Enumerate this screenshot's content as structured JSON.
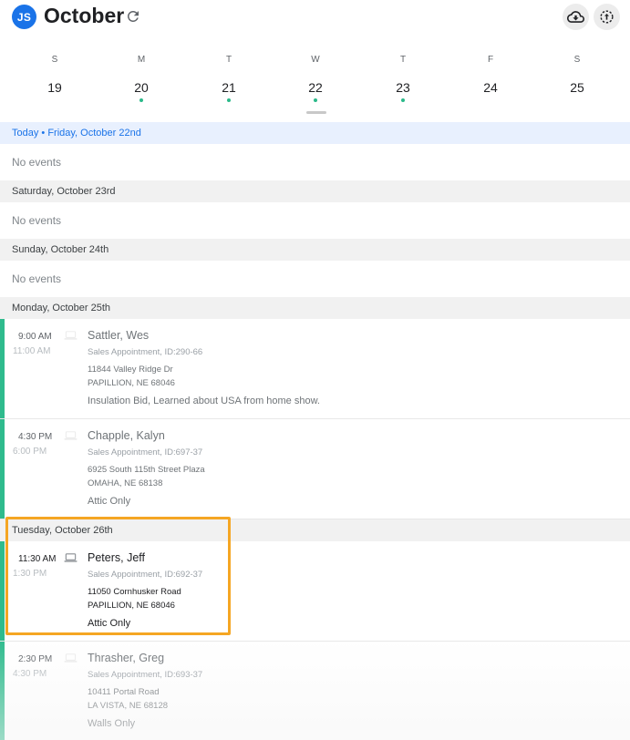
{
  "header": {
    "avatar_initials": "JS",
    "title": "October",
    "icons": {
      "refresh": "refresh-icon",
      "download": "cloud-download-icon",
      "sync": "sync-icon"
    }
  },
  "week": {
    "days": [
      {
        "letter": "S",
        "num": "19",
        "has_events": false
      },
      {
        "letter": "M",
        "num": "20",
        "has_events": true
      },
      {
        "letter": "T",
        "num": "21",
        "has_events": true
      },
      {
        "letter": "W",
        "num": "22",
        "has_events": true
      },
      {
        "letter": "T",
        "num": "23",
        "has_events": true
      },
      {
        "letter": "F",
        "num": "24",
        "has_events": false
      },
      {
        "letter": "S",
        "num": "25",
        "has_events": false
      }
    ]
  },
  "agenda": {
    "today_header": "Today • Friday,  October 22nd",
    "no_events_text": "No events",
    "saturday_header": "Saturday,  October 23rd",
    "sunday_header": "Sunday,  October 24th",
    "monday_header": "Monday,  October 25th",
    "tuesday_header": "Tuesday,  October 26th",
    "events": [
      {
        "start": "9:00 AM",
        "end": "11:00 AM",
        "name": "Sattler, Wes",
        "subtitle": "Sales Appointment, ID:290-66",
        "address1": "11844 Valley Ridge Dr",
        "address2": "PAPILLION, NE 68046",
        "note": "Insulation Bid, Learned about USA from home show."
      },
      {
        "start": "4:30 PM",
        "end": "6:00 PM",
        "name": "Chapple, Kalyn",
        "subtitle": "Sales Appointment, ID:697-37",
        "address1": "6925 South 115th Street Plaza",
        "address2": "OMAHA, NE 68138",
        "note": "Attic Only"
      },
      {
        "start": "11:30 AM",
        "end": "1:30 PM",
        "name": "Peters, Jeff",
        "subtitle": "Sales Appointment, ID:692-37",
        "address1": "11050 Cornhusker Road",
        "address2": "PAPILLION, NE 68046",
        "note": "Attic Only"
      },
      {
        "start": "2:30 PM",
        "end": "4:30 PM",
        "name": "Thrasher, Greg",
        "subtitle": "Sales Appointment, ID:693-37",
        "address1": "10411 Portal Road",
        "address2": "LA VISTA, NE 68128",
        "note": "Walls Only"
      }
    ]
  },
  "colors": {
    "accent": "#1a73e8",
    "event_bar": "#2fbb8d",
    "highlight": "#f5a623"
  }
}
